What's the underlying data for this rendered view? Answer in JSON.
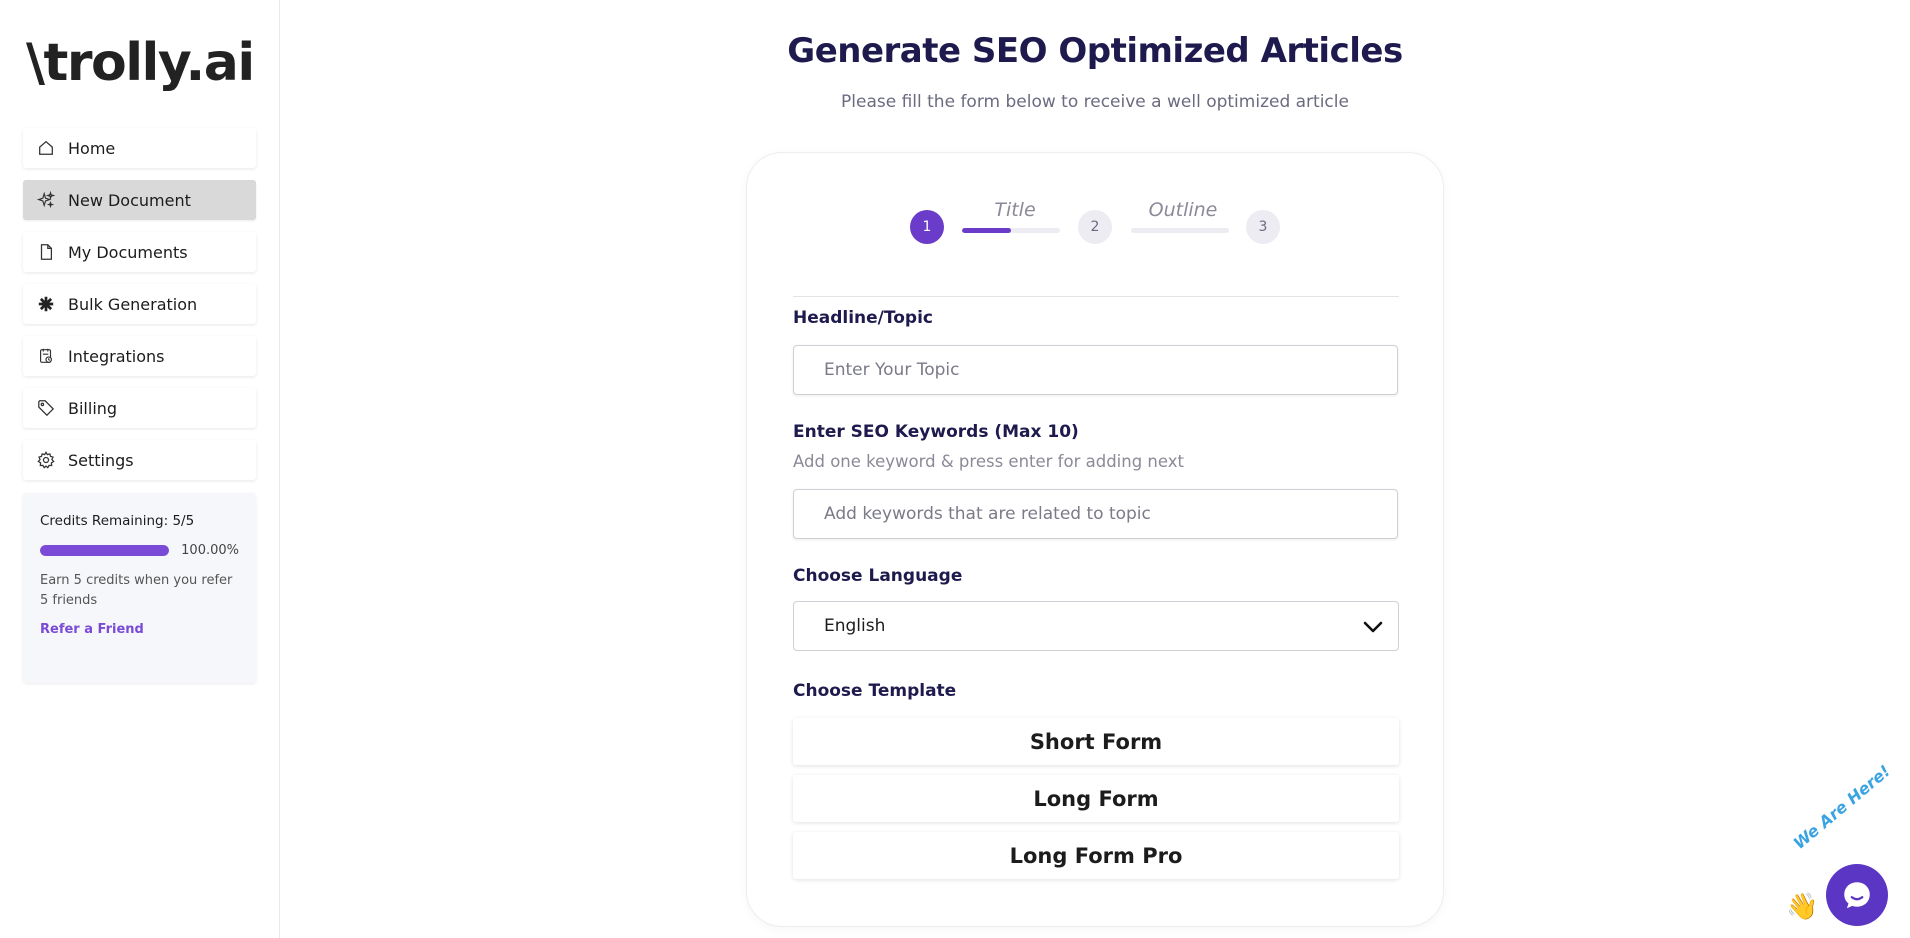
{
  "brand": {
    "logo_text": "\\trolly.ai"
  },
  "sidebar": {
    "items": [
      {
        "label": "Home",
        "icon": "home-icon",
        "active": false
      },
      {
        "label": "New Document",
        "icon": "sparkle-icon",
        "active": true
      },
      {
        "label": "My Documents",
        "icon": "document-icon",
        "active": false
      },
      {
        "label": "Bulk Generation",
        "icon": "asterisk-icon",
        "active": false
      },
      {
        "label": "Integrations",
        "icon": "integrations-icon",
        "active": false
      },
      {
        "label": "Billing",
        "icon": "tag-icon",
        "active": false
      },
      {
        "label": "Settings",
        "icon": "gear-icon",
        "active": false
      }
    ]
  },
  "credits": {
    "title": "Credits Remaining: 5/5",
    "progress_fraction": 1.0,
    "progress_label": "100.00%",
    "description": "Earn 5 credits when you refer 5 friends",
    "refer_label": "Refer a Friend"
  },
  "main": {
    "title": "Generate SEO Optimized Articles",
    "subtitle": "Please fill the form below to receive a well optimized article"
  },
  "stepper": {
    "steps": [
      {
        "number": "1",
        "active": true
      },
      {
        "number": "2",
        "active": false
      },
      {
        "number": "3",
        "active": false
      }
    ],
    "labels": [
      {
        "text": "Title",
        "progress_fraction": 0.5
      },
      {
        "text": "Outline",
        "progress_fraction": 0
      }
    ]
  },
  "form": {
    "headline_label": "Headline/Topic",
    "headline_placeholder": "Enter Your Topic",
    "headline_value": "",
    "keywords_label": "Enter SEO Keywords (Max 10)",
    "keywords_hint": "Add one keyword & press enter for adding next",
    "keywords_placeholder": "Add keywords that are related to topic",
    "language_label": "Choose Language",
    "language_value": "English",
    "template_label": "Choose Template",
    "templates": [
      "Short Form",
      "Long Form",
      "Long Form Pro"
    ]
  },
  "chat_widget": {
    "caption": "We Are Here!"
  },
  "colors": {
    "accent": "#6a3cc9",
    "progress": "#7a4bd6",
    "title": "#1e1a4d"
  }
}
